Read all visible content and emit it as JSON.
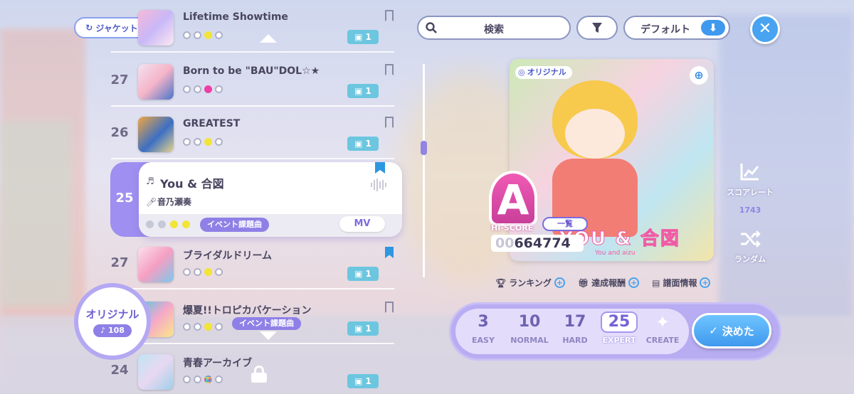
{
  "controls": {
    "jacket_button": "ジャケット",
    "search_label": "検索",
    "sort_label": "デフォルト",
    "close_symbol": "✕"
  },
  "song_list": [
    {
      "rank": "",
      "title": "Lifetime Showtime",
      "levels": [
        "empty",
        "empty",
        "yellow",
        "empty"
      ],
      "mv_count": "1",
      "bookmarked": false,
      "event": ""
    },
    {
      "rank": "27",
      "title": "Born to be \"BAU\"DOL☆★",
      "levels": [
        "empty",
        "empty",
        "pink",
        "empty"
      ],
      "mv_count": "1",
      "bookmarked": false,
      "event": ""
    },
    {
      "rank": "26",
      "title": "GREATEST",
      "levels": [
        "empty",
        "empty",
        "yellow",
        "empty"
      ],
      "mv_count": "1",
      "bookmarked": false,
      "event": ""
    },
    {
      "rank": "27",
      "title": "ブライダルドリーム",
      "levels": [
        "empty",
        "empty",
        "yellow",
        "empty"
      ],
      "mv_count": "1",
      "bookmarked": true,
      "event": ""
    },
    {
      "rank": "27",
      "title": "爆夏!!トロピカバケーション",
      "levels": [
        "empty",
        "empty",
        "yellow",
        "empty"
      ],
      "mv_count": "1",
      "bookmarked": false,
      "event": "イベント課題曲"
    },
    {
      "rank": "24",
      "title": "青春アーカイブ",
      "levels": [
        "empty",
        "empty",
        "rainbow",
        "empty"
      ],
      "mv_count": "1",
      "bookmarked": false,
      "event": ""
    }
  ],
  "selected_song": {
    "rank": "25",
    "title": "You & 合図",
    "artist": "音乃瀬奏",
    "event_tag": "イベント課題曲",
    "mv_button": "MV"
  },
  "category": {
    "label": "オリジナル",
    "count": "108"
  },
  "jacket_art": {
    "tag": "オリジナル",
    "logo_text": "YOU & 合図",
    "logo_sub": "You and aizu"
  },
  "score": {
    "rank": "A",
    "hiscore_label": "HI-SCORE",
    "list_button": "一覧",
    "prefix": "00",
    "value": "664774"
  },
  "info_links": {
    "ranking": "ランキング",
    "rewards": "達成報酬",
    "chart_info": "譜面情報"
  },
  "side_actions": {
    "score_rate_label": "スコアレート",
    "score_rate_value": "1743",
    "random_label": "ランダム"
  },
  "difficulties": [
    {
      "level": "3",
      "name": "EASY"
    },
    {
      "level": "10",
      "name": "NORMAL"
    },
    {
      "level": "17",
      "name": "HARD"
    },
    {
      "level": "25",
      "name": "EXPERT"
    },
    {
      "level": "",
      "name": "CREATE"
    }
  ],
  "decide_button": "決めた",
  "colors": {
    "accent_purple": "#8e80e6",
    "accent_blue": "#3f99ee",
    "rank_pink": "#f05ab4"
  }
}
